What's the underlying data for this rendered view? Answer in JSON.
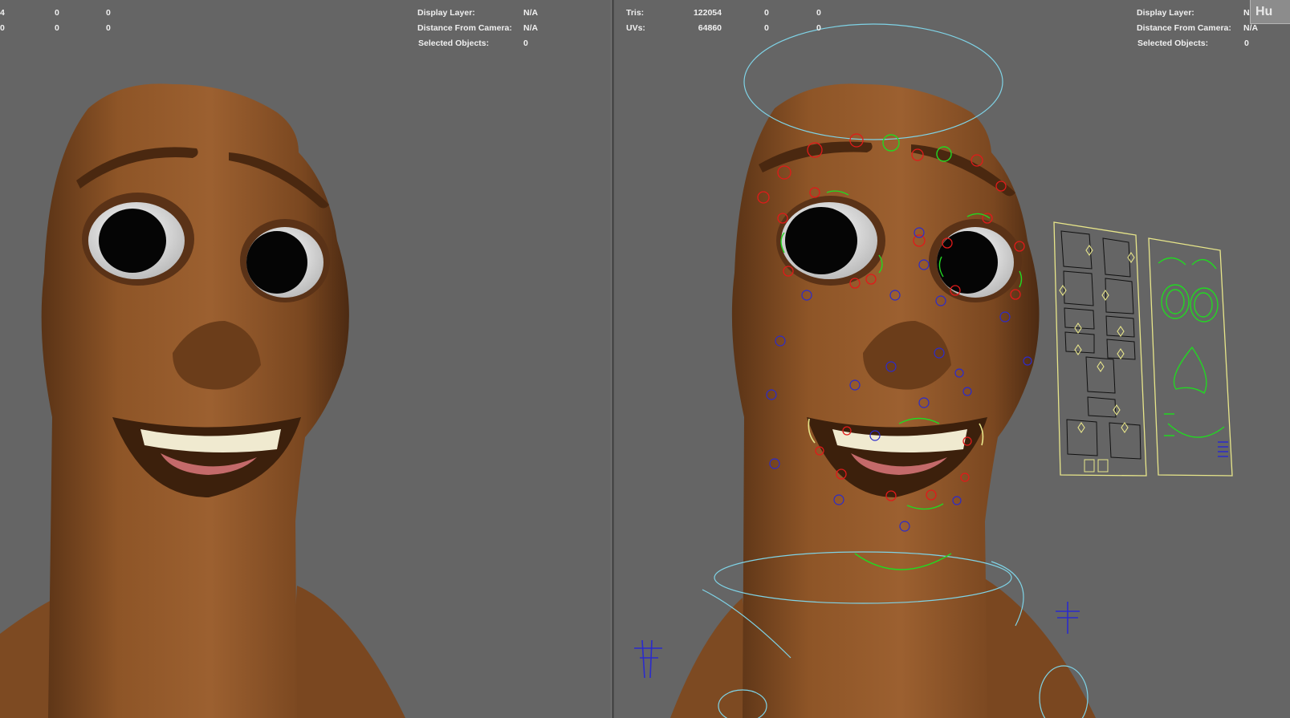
{
  "left_viewport": {
    "poly_rows": [
      {
        "label": "",
        "value": "4",
        "c2": "0",
        "c3": "0"
      },
      {
        "label": "",
        "value": "0",
        "c2": "0",
        "c3": "0"
      }
    ],
    "info": [
      {
        "label": "Display Layer:",
        "value": "N/A"
      },
      {
        "label": "Distance From Camera:",
        "value": "N/A"
      },
      {
        "label": "Selected Objects:",
        "value": "0"
      }
    ]
  },
  "right_viewport": {
    "poly_rows": [
      {
        "label": "Tris:",
        "value": "122054",
        "c2": "0",
        "c3": "0"
      },
      {
        "label": "UVs:",
        "value": "64860",
        "c2": "0",
        "c3": "0"
      }
    ],
    "info": [
      {
        "label": "Display Layer:",
        "value": "N/A"
      },
      {
        "label": "Distance From Camera:",
        "value": "N/A"
      },
      {
        "label": "Selected Objects:",
        "value": "0"
      }
    ],
    "corner_text": "Hu"
  },
  "colors": {
    "viewport_bg": "#656565",
    "wood": "#8a5126",
    "ctrl_red": "#e01a1a",
    "ctrl_green": "#22d822",
    "ctrl_blue": "#2b2bcc",
    "ctrl_cyan": "#7fd3e6",
    "ctrl_yellow": "#e8e68a"
  }
}
